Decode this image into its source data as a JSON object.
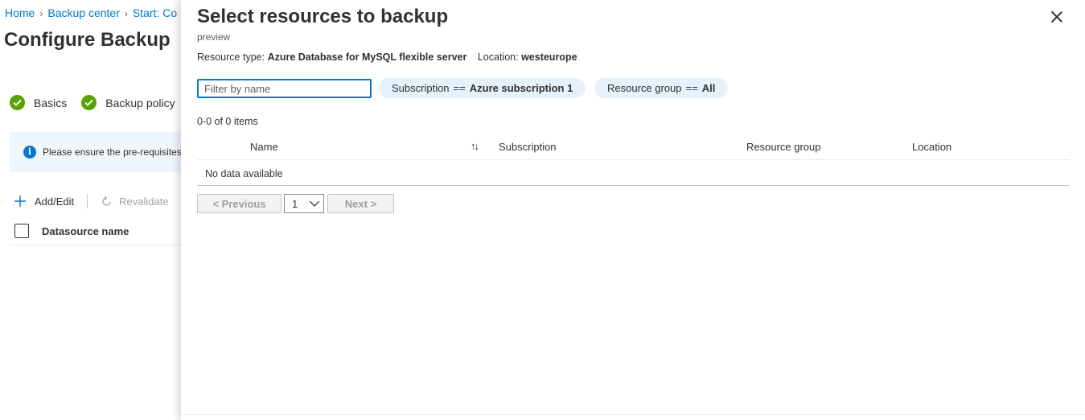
{
  "breadcrumb": {
    "items": [
      "Home",
      "Backup center",
      "Start: Co"
    ]
  },
  "page": {
    "title": "Configure Backup"
  },
  "steps": [
    {
      "label": "Basics"
    },
    {
      "label": "Backup policy"
    }
  ],
  "info": {
    "text": "Please ensure the pre-requisites"
  },
  "commands": {
    "add_edit": "Add/Edit",
    "revalidate": "Revalidate"
  },
  "datasource_table": {
    "header": "Datasource name"
  },
  "blade": {
    "title": "Select resources to backup",
    "subtitle": "preview",
    "resource_type_label": "Resource type:",
    "resource_type_value": "Azure Database for MySQL flexible server",
    "location_label": "Location:",
    "location_value": "westeurope",
    "filter_placeholder": "Filter by name",
    "subscription_pill": {
      "key": "Subscription",
      "op": "==",
      "value": "Azure subscription 1"
    },
    "resource_group_pill": {
      "key": "Resource group",
      "op": "==",
      "value": "All"
    },
    "item_count": "0-0 of 0 items",
    "columns": [
      "Name",
      "Subscription",
      "Resource group",
      "Location"
    ],
    "empty_text": "No data available",
    "pager": {
      "previous": "< Previous",
      "page": "1",
      "next": "Next >"
    }
  },
  "colors": {
    "accent": "#0078d4",
    "success": "#57a300",
    "pill_bg": "#e5f1fb",
    "info_bg": "#eff6fc"
  }
}
